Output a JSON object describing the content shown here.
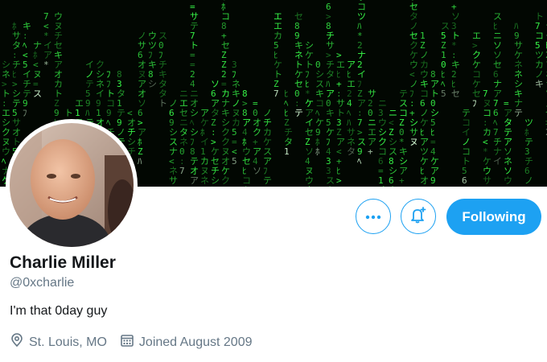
{
  "profile": {
    "name": "Charlie Miller",
    "handle": "@0xcharlie",
    "bio": "I'm that 0day guy",
    "location": "St. Louis, MO",
    "joined": "Joined August 2009"
  },
  "actions": {
    "more_icon": "more-icon",
    "notify_icon": "bell-plus-icon",
    "follow_label": "Following"
  },
  "colors": {
    "accent": "#1da1f2",
    "banner_bg": "#020702",
    "matrix_green": "#39ff4a"
  },
  "icons": {
    "location": "location-pin-icon",
    "calendar": "calendar-icon"
  }
}
